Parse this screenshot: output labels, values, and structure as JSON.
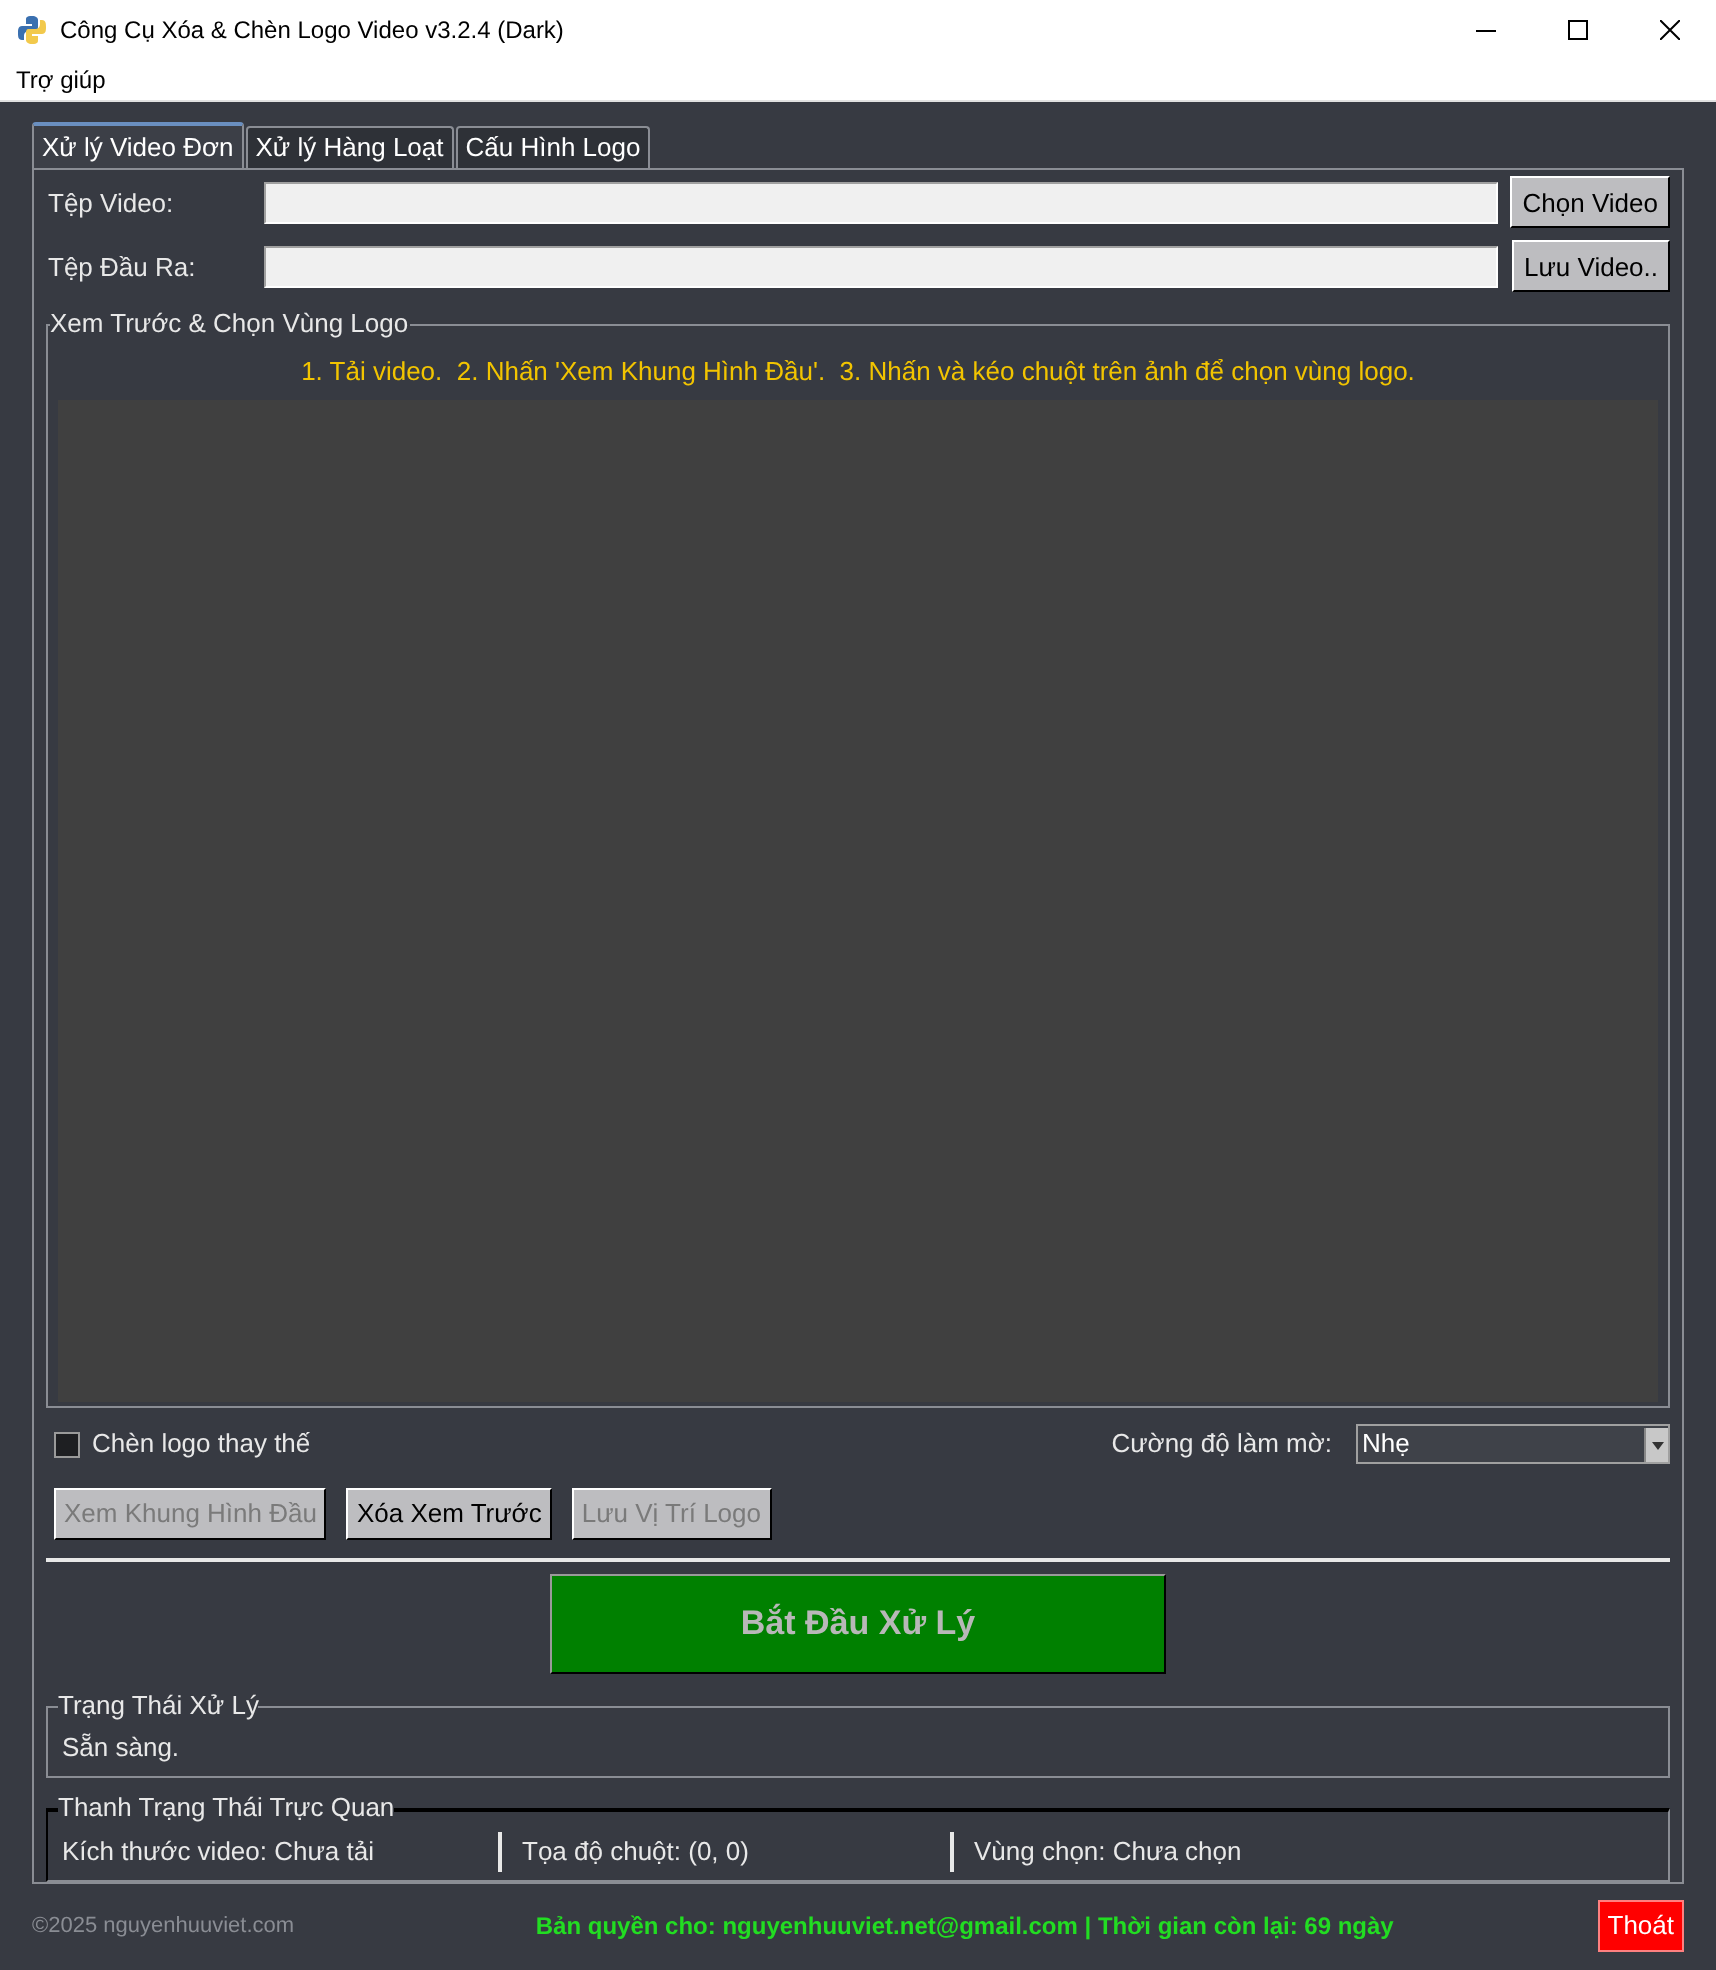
{
  "window": {
    "title": "Công Cụ Xóa & Chèn Logo Video v3.2.4 (Dark)"
  },
  "menu": [
    "Trợ giúp"
  ],
  "tabs": [
    {
      "label": "Xử lý Video Đơn",
      "selected": true
    },
    {
      "label": "Xử lý Hàng Loạt",
      "selected": false
    },
    {
      "label": "Cấu Hình Logo",
      "selected": false
    }
  ],
  "file_rows": [
    {
      "label": "Tệp Video:",
      "button": "Chọn Video"
    },
    {
      "label": "Tệp Đầu Ra:",
      "button": "Lưu Video.."
    }
  ],
  "preview": {
    "title": "Xem Trước & Chọn Vùng Logo",
    "hint": "1. Tải video.  2. Nhấn 'Xem Khung Hình Đầu'.  3. Nhấn và kéo chuột trên ảnh để chọn vùng logo."
  },
  "replace_logo": {
    "label": "Chèn logo thay thế",
    "checked": false
  },
  "blur": {
    "label": "Cường độ làm mờ:",
    "value": "Nhẹ"
  },
  "actions": [
    {
      "label": "Xem Khung Hình Đầu",
      "disabled": true
    },
    {
      "label": "Xóa Xem Trước",
      "disabled": false
    },
    {
      "label": "Lưu Vị Trí Logo",
      "disabled": true
    }
  ],
  "start_button": {
    "label": "Bắt Đầu Xử Lý",
    "disabled": true
  },
  "status": {
    "title": "Trạng Thái Xử Lý",
    "text": "Sẵn sàng."
  },
  "visual_status": {
    "title": "Thanh Trạng Thái Trực Quan",
    "fields": [
      "Kích thước video: Chưa tải",
      "Tọa độ chuột: (0, 0)",
      "Vùng chọn: Chưa chọn"
    ]
  },
  "footer": {
    "copyright": "©2025 nguyenhuuviet.com",
    "license": "Bản quyền cho: nguyenhuuviet.net@gmail.com | Thời gian còn lại: 69 ngày",
    "exit": "Thoát"
  }
}
